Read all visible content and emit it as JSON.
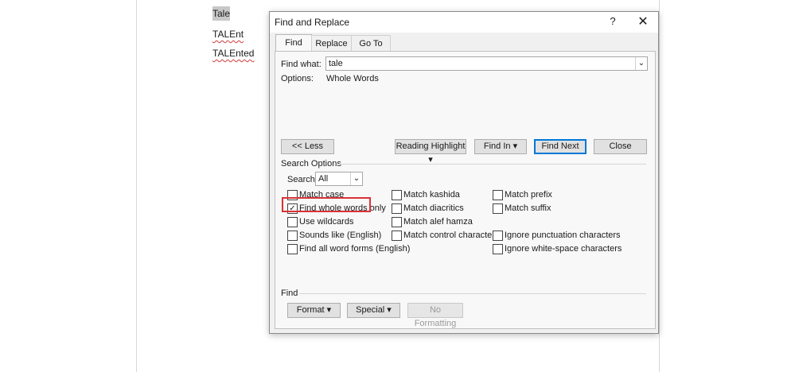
{
  "document": {
    "words": [
      "Tale",
      "TALEnt",
      "TALEnted"
    ]
  },
  "dialog": {
    "title": "Find and Replace",
    "help_label": "?",
    "close_label": "✕",
    "tabs": [
      "Find",
      "Replace",
      "Go To"
    ],
    "find_what_label": "Find what:",
    "find_what_value": "tale",
    "options_label": "Options:",
    "options_value": "Whole Words",
    "buttons": {
      "less": "<< Less",
      "reading_highlight": "Reading Highlight ▾",
      "find_in": "Find In ▾",
      "find_next": "Find Next",
      "close": "Close"
    },
    "search_options_label": "Search Options",
    "search_label": "Search;",
    "search_value": "All",
    "checkboxes_col1": [
      {
        "label": "Match case",
        "checked": false
      },
      {
        "label": "Find whole words only",
        "checked": true
      },
      {
        "label": "Use wildcards",
        "checked": false
      },
      {
        "label": "Sounds like (English)",
        "checked": false
      },
      {
        "label": "Find all word forms (English)",
        "checked": false
      }
    ],
    "checkboxes_col2": [
      {
        "label": "Match kashida",
        "checked": false
      },
      {
        "label": "Match diacritics",
        "checked": false
      },
      {
        "label": "Match alef hamza",
        "checked": false
      },
      {
        "label": "Match control characters",
        "checked": false
      }
    ],
    "checkboxes_col3": [
      {
        "label": "Match prefix",
        "checked": false
      },
      {
        "label": "Match suffix",
        "checked": false
      },
      {
        "label": "Ignore punctuation characters",
        "checked": false
      },
      {
        "label": "Ignore white-space characters",
        "checked": false
      }
    ],
    "find_section_label": "Find",
    "bottom_buttons": {
      "format": "Format ▾",
      "special": "Special ▾",
      "no_formatting": "No Formatting"
    }
  },
  "colors": {
    "highlight_border": "#d93236",
    "primary_button_border": "#0078d7"
  }
}
